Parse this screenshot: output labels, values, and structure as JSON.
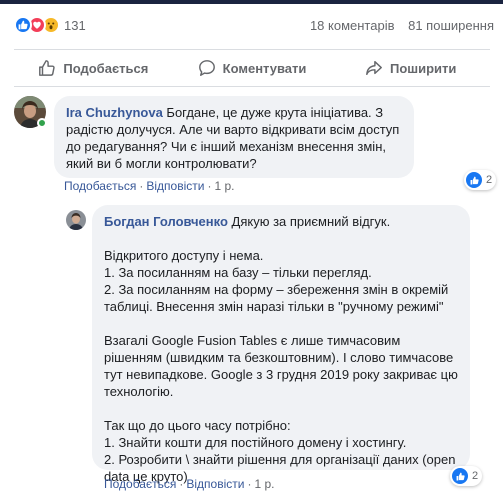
{
  "post_stats": {
    "reaction_icons": [
      "like-icon",
      "love-icon",
      "wow-icon"
    ],
    "reaction_count": "131",
    "comments_count": "18 коментарів",
    "shares_count": "81 поширення"
  },
  "actions": {
    "like_label": "Подобається",
    "comment_label": "Коментувати",
    "share_label": "Поширити"
  },
  "comments": [
    {
      "author": "Ira Chuzhynova",
      "text": "Богдане, це дуже крута ініціатива. З радістю долучуся. Але чи варто відкривати всім доступ до редагування? Чи є інший механізм внесення змін, який ви б могли контролювати?",
      "like_link": "Подобається",
      "reply_link": "Відповісти",
      "age": "1 р.",
      "likes": "2"
    },
    {
      "author": "Богдан Головченко",
      "paragraphs": [
        "Дякую за приємний відгук.",
        "Відкритого доступу і нема.\n1. За посиланням на базу – тільки перегляд.\n2. За посиланням на форму – збереження змін в окремій таблиці. Внесення змін наразі тільки в \"ручному режимі\"",
        "Взагалі Google Fusion Tables є лише тимчасовим рішенням (швидким та безкоштовним). І слово тимчасове тут невипадкове. Google з 3 грудня 2019 року закриває цю технологію.",
        "Так що до цього часу потрібно:\n1. Знайти кошти для постійного домену і хостингу.\n2. Розробити \\ знайти рішення для організації даних (open data це круто)"
      ],
      "like_link": "Подобається",
      "reply_link": "Відповісти",
      "age": "1 р.",
      "likes": "2"
    }
  ],
  "colors": {
    "link": "#385898",
    "meta": "#65676b",
    "bubble": "#f0f2f5",
    "like_blue": "#1877f2",
    "love_red": "#f33e58",
    "wow_yellow": "#f7b928",
    "online_green": "#31a24c"
  }
}
